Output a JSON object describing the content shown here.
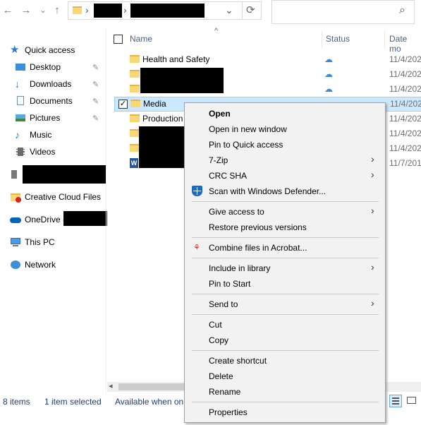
{
  "toolbar": {
    "back": "←",
    "forward": "→",
    "recent": "⌄",
    "up": "↑",
    "address_chevron": "›",
    "address_dropdown": "⌄",
    "refresh": "⟳",
    "search_icon": "⌕"
  },
  "sidebar": {
    "quick_access": "Quick access",
    "desktop": "Desktop",
    "downloads": "Downloads",
    "documents": "Documents",
    "pictures": "Pictures",
    "music": "Music",
    "videos": "Videos",
    "creative_cloud": "Creative Cloud Files",
    "onedrive": "OneDrive -",
    "this_pc": "This PC",
    "network": "Network"
  },
  "columns": {
    "name": "Name",
    "status": "Status",
    "date": "Date mo",
    "sort_arrow": "^"
  },
  "files": [
    {
      "name": "Health and Safety",
      "date": "11/4/202"
    },
    {
      "name": "",
      "date": "11/4/202"
    },
    {
      "name": "",
      "date": "11/4/202"
    },
    {
      "name": "Media",
      "date": "11/4/202"
    },
    {
      "name": "Production",
      "date": "11/4/202"
    },
    {
      "name": "",
      "date": "11/4/202"
    },
    {
      "name": "",
      "date": "11/4/202"
    },
    {
      "name": "",
      "date": "11/7/201"
    }
  ],
  "statusbar": {
    "count": "8 items",
    "selected": "1 item selected",
    "availability": "Available when on"
  },
  "context_menu": {
    "open": "Open",
    "open_new_window": "Open in new window",
    "pin_quick_access": "Pin to Quick access",
    "seven_zip": "7-Zip",
    "crc_sha": "CRC SHA",
    "scan_defender": "Scan with Windows Defender...",
    "give_access": "Give access to",
    "restore_versions": "Restore previous versions",
    "combine_acrobat": "Combine files in Acrobat...",
    "include_library": "Include in library",
    "pin_start": "Pin to Start",
    "send_to": "Send to",
    "cut": "Cut",
    "copy": "Copy",
    "create_shortcut": "Create shortcut",
    "delete": "Delete",
    "rename": "Rename",
    "properties": "Properties",
    "submenu_arrow": "›"
  },
  "colors": {
    "selection": "#cce8ff",
    "folder": "#f8d775",
    "accent": "#0078d7"
  }
}
